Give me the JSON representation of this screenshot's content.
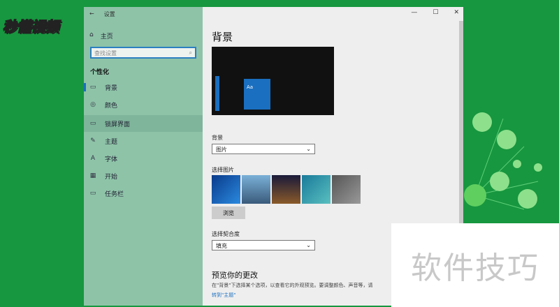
{
  "logo": "秒懂视频",
  "window": {
    "back": "←",
    "title": "设置",
    "controls": [
      "—",
      "☐",
      "✕"
    ]
  },
  "sidebar": {
    "home": "主页",
    "search_placeholder": "查找设置",
    "section": "个性化",
    "items": [
      {
        "icon": "▭",
        "label": "背景"
      },
      {
        "icon": "◎",
        "label": "颜色"
      },
      {
        "icon": "▭",
        "label": "锁屏界面"
      },
      {
        "icon": "✎",
        "label": "主题"
      },
      {
        "icon": "A",
        "label": "字体"
      },
      {
        "icon": "▦",
        "label": "开始"
      },
      {
        "icon": "▭",
        "label": "任务栏"
      }
    ]
  },
  "main": {
    "title": "背景",
    "preview_tile": "Aa",
    "bg_label": "背景",
    "bg_value": "图片",
    "pick_label": "选择图片",
    "browse": "浏览",
    "fit_label": "选择契合度",
    "fit_value": "填充",
    "preview_heading": "预览你的更改",
    "preview_desc": "在\"背景\"下选择某个选项，以查看它的外观预览。要调整颜色、声音等，请",
    "theme_link": "转到\"主题\""
  },
  "watermark": "软件技巧"
}
